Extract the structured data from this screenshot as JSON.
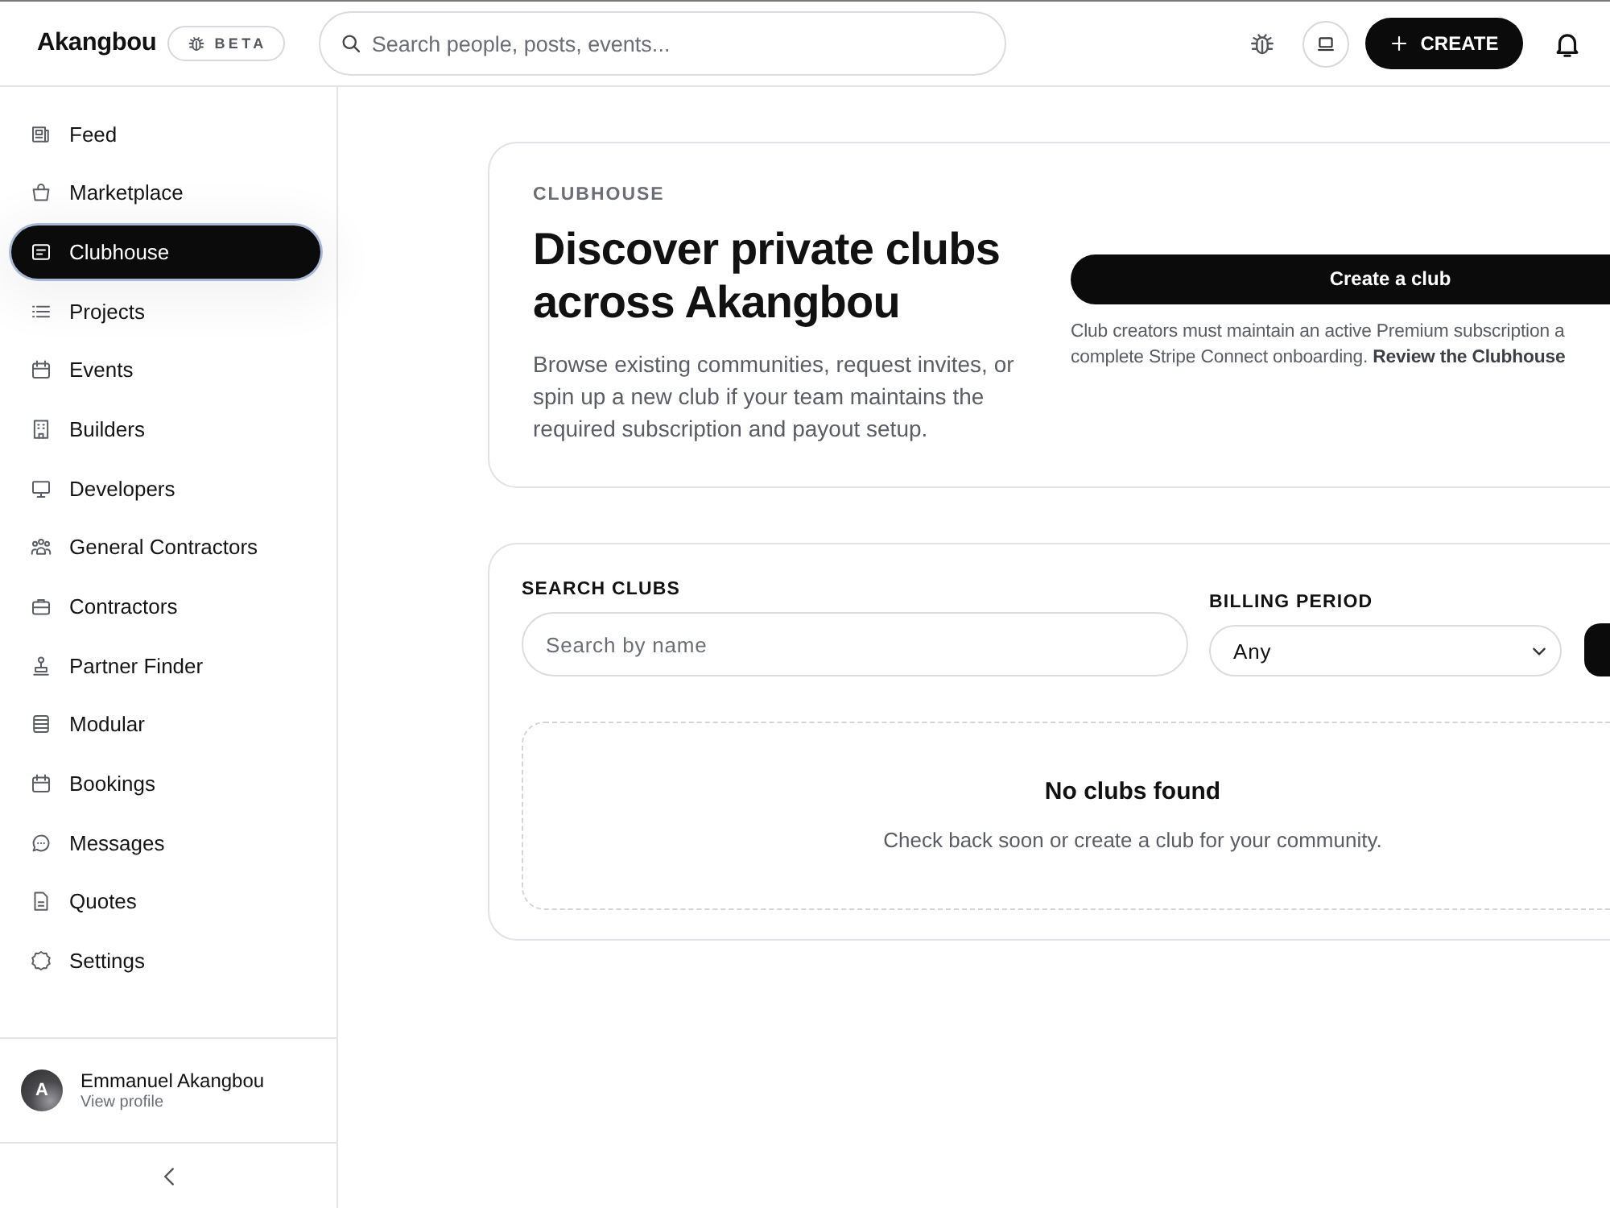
{
  "topbar": {
    "brand": "Akangbou",
    "badge": "BETA",
    "search": {
      "placeholder": "Search people, posts, events..."
    },
    "create_button": "CREATE"
  },
  "sidebar": {
    "items": [
      {
        "label": "Feed",
        "selected": false
      },
      {
        "label": "Marketplace",
        "selected": false
      },
      {
        "label": "Clubhouse",
        "selected": true
      },
      {
        "label": "Projects",
        "selected": false
      },
      {
        "label": "Events",
        "selected": false
      },
      {
        "label": "Builders",
        "selected": false
      },
      {
        "label": "Developers",
        "selected": false
      },
      {
        "label": "General Contractors",
        "selected": false
      },
      {
        "label": "Contractors",
        "selected": false
      },
      {
        "label": "Partner Finder",
        "selected": false
      },
      {
        "label": "Modular",
        "selected": false
      },
      {
        "label": "Bookings",
        "selected": false
      },
      {
        "label": "Messages",
        "selected": false
      },
      {
        "label": "Quotes",
        "selected": false
      },
      {
        "label": "Settings",
        "selected": false
      }
    ],
    "user": {
      "initial": "A",
      "name": "Emmanuel Akangbou",
      "link": "View profile"
    }
  },
  "hero": {
    "eyebrow": "CLUBHOUSE",
    "title": "Discover private clubs across Akangbou",
    "description": "Browse existing communities, request invites, or spin up a new club if your team maintains the required subscription and payout setup.",
    "action": "Create a club",
    "note": {
      "lines": [
        "Club creators must maintain an active Premium subscription a",
        "complete Stripe Connect onboarding."
      ],
      "link": "Review the Clubhouse"
    }
  },
  "filters": {
    "search": {
      "label": "SEARCH CLUBS",
      "placeholder": "Search by name"
    },
    "billing": {
      "label": "BILLING PERIOD",
      "value": "Any"
    }
  },
  "empty_state": {
    "title": "No clubs found",
    "message": "Check back soon or create a club for your community."
  }
}
